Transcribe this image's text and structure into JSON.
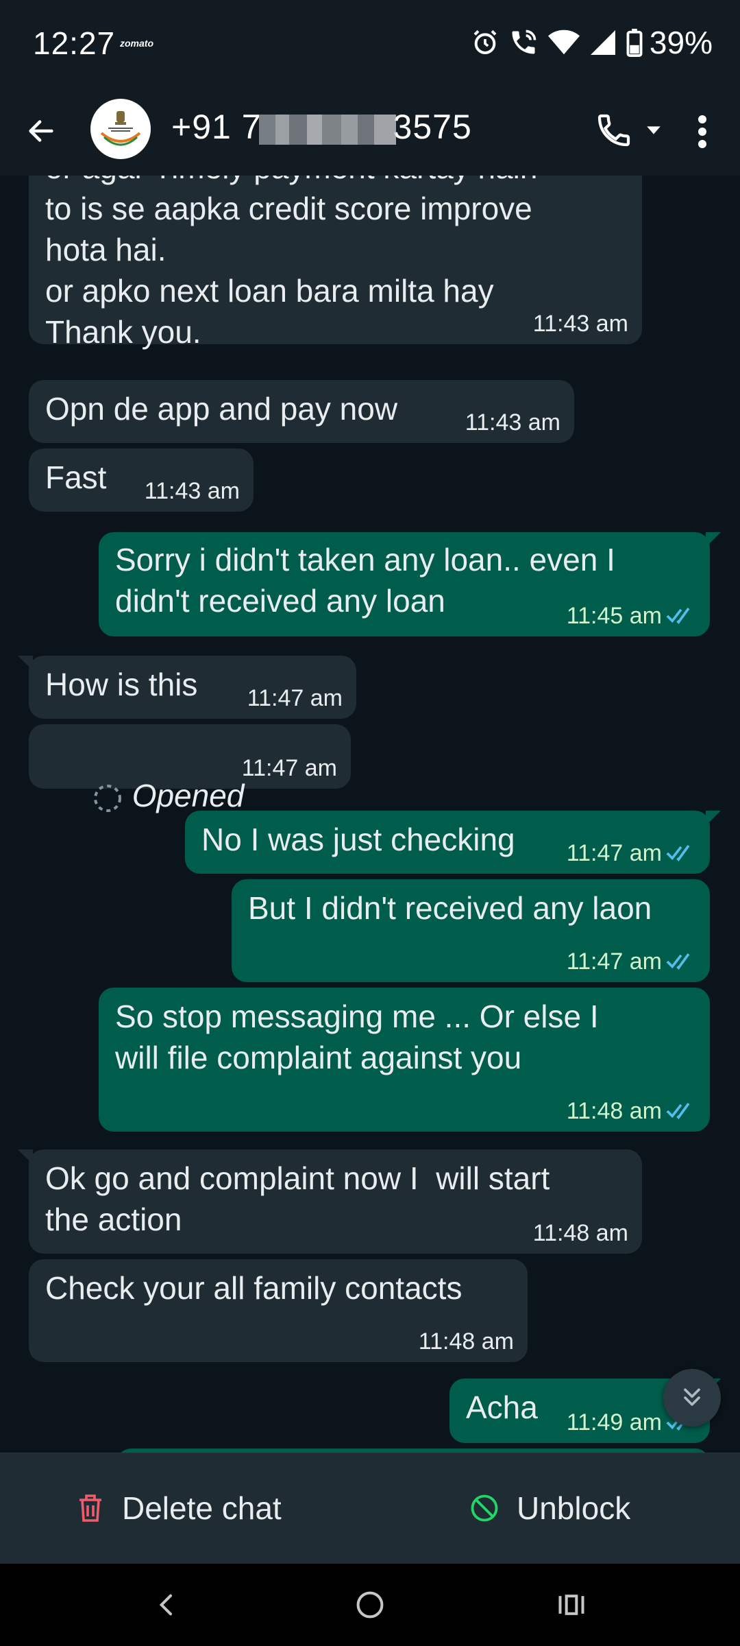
{
  "status_bar": {
    "time": "12:27",
    "app_label": "zomato",
    "battery": "39%"
  },
  "header": {
    "contact_prefix": "+91 7",
    "contact_suffix": "3575"
  },
  "messages": [
    {
      "dir": "in",
      "text": "or agar Timely payment kartay hain\nto is se aapka credit score improve\nhota hai.\nor apko next loan bara milta hay\nThank you.",
      "time": "11:43 am"
    },
    {
      "dir": "in",
      "text": "Opn de app and pay now",
      "time": "11:43 am"
    },
    {
      "dir": "in",
      "text": "Fast",
      "time": "11:43 am"
    },
    {
      "dir": "out",
      "text": "Sorry i didn't taken any loan.. even I\ndidn't received any loan",
      "time": "11:45 am"
    },
    {
      "dir": "in",
      "text": "How is this",
      "time": "11:47 am"
    },
    {
      "dir": "in",
      "text": "Opened",
      "time": "11:47 am"
    },
    {
      "dir": "out",
      "text": "No I was just checking",
      "time": "11:47 am"
    },
    {
      "dir": "out",
      "text": "But I didn't received any laon",
      "time": "11:47 am"
    },
    {
      "dir": "out",
      "text": "So stop messaging me ... Or else I\nwill file complaint against you",
      "time": "11:48 am"
    },
    {
      "dir": "in",
      "text": "Ok go and complaint now I  will start\nthe action",
      "time": "11:48 am"
    },
    {
      "dir": "in",
      "text": "Check your all family contacts",
      "time": "11:48 am"
    },
    {
      "dir": "out",
      "text": "Acha",
      "time": "11:49 am"
    }
  ],
  "actions": {
    "delete_label": "Delete chat",
    "unblock_label": "Unblock"
  },
  "colors": {
    "incoming_bubble": "#1f2c34",
    "outgoing_bubble": "#005c4b",
    "read_ticks": "#53bdeb",
    "delete_red": "#f15c6d",
    "unblock_green": "#25d366"
  },
  "icons": [
    "back-arrow-icon",
    "phone-icon",
    "chevron-down-icon",
    "more-vertical-icon",
    "double-tick-icon",
    "view-once-icon",
    "scroll-down-icon",
    "trash-icon",
    "unblock-icon",
    "alarm-icon",
    "wifi-call-icon",
    "wifi-icon",
    "signal-icon",
    "battery-icon"
  ]
}
